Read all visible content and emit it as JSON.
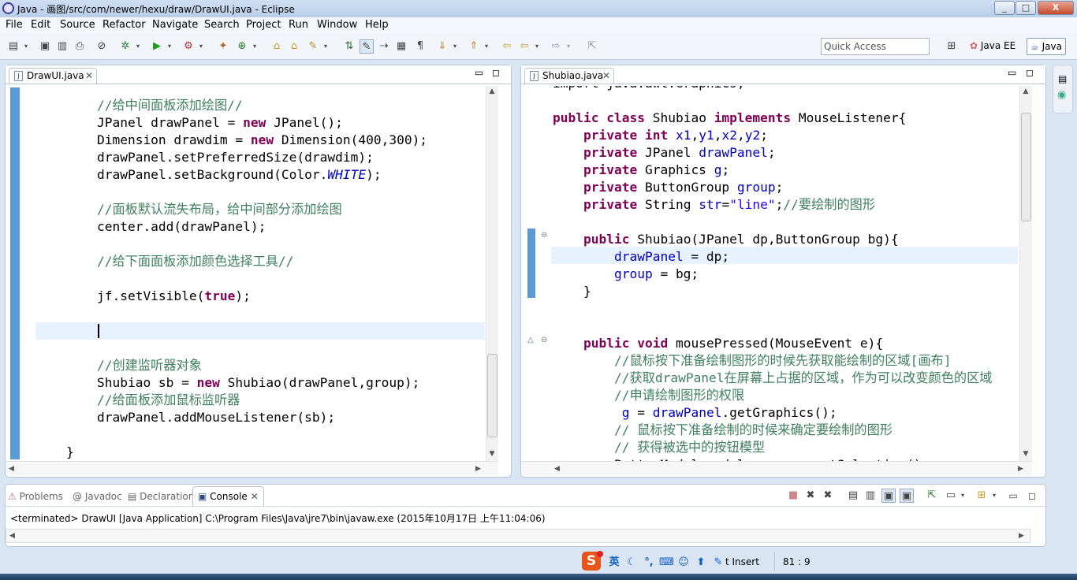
{
  "window": {
    "title": "Java - 画图/src/com/newer/hexu/draw/DrawUI.java - Eclipse",
    "minimize": "_",
    "maximize": "□",
    "close": "X"
  },
  "menu": [
    "File",
    "Edit",
    "Source",
    "Refactor",
    "Navigate",
    "Search",
    "Project",
    "Run",
    "Window",
    "Help"
  ],
  "quick_access": {
    "placeholder": "Quick Access"
  },
  "perspectives": [
    "Java EE",
    "Java"
  ],
  "editor_left": {
    "tab": "DrawUI.java",
    "lines": [
      [
        {
          "t": "        "
        },
        {
          "t": "//给中间面板添加绘图//",
          "c": "cm"
        }
      ],
      [
        {
          "t": "        JPanel drawPanel = "
        },
        {
          "t": "new",
          "c": "kw"
        },
        {
          "t": " JPanel();"
        }
      ],
      [
        {
          "t": "        Dimension drawdim = "
        },
        {
          "t": "new",
          "c": "kw"
        },
        {
          "t": " Dimension(400,300);"
        }
      ],
      [
        {
          "t": "        drawPanel.setPreferredSize(drawdim);"
        }
      ],
      [
        {
          "t": "        drawPanel.setBackground(Color."
        },
        {
          "t": "WHITE",
          "c": "it"
        },
        {
          "t": ");"
        }
      ],
      [
        {
          "t": ""
        }
      ],
      [
        {
          "t": "        "
        },
        {
          "t": "//面板默认流失布局，给中间部分添加绘图",
          "c": "cm"
        }
      ],
      [
        {
          "t": "        center.add(drawPanel);"
        }
      ],
      [
        {
          "t": ""
        }
      ],
      [
        {
          "t": "        "
        },
        {
          "t": "//给下面面板添加颜色选择工具//",
          "c": "cm"
        }
      ],
      [
        {
          "t": ""
        }
      ],
      [
        {
          "t": "        jf.setVisible("
        },
        {
          "t": "true",
          "c": "kw"
        },
        {
          "t": ");"
        }
      ],
      [
        {
          "t": ""
        }
      ],
      [
        {
          "t": ""
        }
      ],
      [
        {
          "t": ""
        }
      ],
      [
        {
          "t": "        "
        },
        {
          "t": "//创建监听器对象",
          "c": "cm"
        }
      ],
      [
        {
          "t": "        Shubiao sb = "
        },
        {
          "t": "new",
          "c": "kw"
        },
        {
          "t": " Shubiao(drawPanel,group);"
        }
      ],
      [
        {
          "t": "        "
        },
        {
          "t": "//给面板添加鼠标监听器",
          "c": "cm"
        }
      ],
      [
        {
          "t": "        drawPanel.addMouseListener(sb);"
        }
      ],
      [
        {
          "t": ""
        }
      ],
      [
        {
          "t": "    }"
        }
      ]
    ]
  },
  "editor_right": {
    "tab": "Shubiao.java",
    "lines": [
      [
        {
          "t": "import java.awt.Graphics;"
        }
      ],
      [
        {
          "t": ""
        }
      ],
      [
        {
          "t": "public",
          "c": "kw"
        },
        {
          "t": " "
        },
        {
          "t": "class",
          "c": "kw"
        },
        {
          "t": " Shubiao "
        },
        {
          "t": "implements",
          "c": "kw"
        },
        {
          "t": " MouseListener{"
        }
      ],
      [
        {
          "t": "    "
        },
        {
          "t": "private",
          "c": "kw"
        },
        {
          "t": " "
        },
        {
          "t": "int",
          "c": "kw"
        },
        {
          "t": " "
        },
        {
          "t": "x1",
          "c": "fld"
        },
        {
          "t": ","
        },
        {
          "t": "y1",
          "c": "fld"
        },
        {
          "t": ","
        },
        {
          "t": "x2",
          "c": "fld"
        },
        {
          "t": ","
        },
        {
          "t": "y2",
          "c": "fld"
        },
        {
          "t": ";"
        }
      ],
      [
        {
          "t": "    "
        },
        {
          "t": "private",
          "c": "kw"
        },
        {
          "t": " JPanel "
        },
        {
          "t": "drawPanel",
          "c": "fld"
        },
        {
          "t": ";"
        }
      ],
      [
        {
          "t": "    "
        },
        {
          "t": "private",
          "c": "kw"
        },
        {
          "t": " Graphics "
        },
        {
          "t": "g",
          "c": "fld"
        },
        {
          "t": ";"
        }
      ],
      [
        {
          "t": "    "
        },
        {
          "t": "private",
          "c": "kw"
        },
        {
          "t": " ButtonGroup "
        },
        {
          "t": "group",
          "c": "fld"
        },
        {
          "t": ";"
        }
      ],
      [
        {
          "t": "    "
        },
        {
          "t": "private",
          "c": "kw"
        },
        {
          "t": " String "
        },
        {
          "t": "str",
          "c": "fld"
        },
        {
          "t": "="
        },
        {
          "t": "\"line\"",
          "c": "st"
        },
        {
          "t": ";"
        },
        {
          "t": "//要绘制的图形",
          "c": "cm"
        }
      ],
      [
        {
          "t": ""
        }
      ],
      [
        {
          "t": "    "
        },
        {
          "t": "public",
          "c": "kw"
        },
        {
          "t": " Shubiao(JPanel dp,ButtonGroup bg){"
        }
      ],
      [
        {
          "t": "        "
        },
        {
          "t": "drawPanel",
          "c": "fld"
        },
        {
          "t": " = dp;"
        }
      ],
      [
        {
          "t": "        "
        },
        {
          "t": "group",
          "c": "fld"
        },
        {
          "t": " = bg;"
        }
      ],
      [
        {
          "t": "    }"
        }
      ],
      [
        {
          "t": ""
        }
      ],
      [
        {
          "t": ""
        }
      ],
      [
        {
          "t": "    "
        },
        {
          "t": "public",
          "c": "kw"
        },
        {
          "t": " "
        },
        {
          "t": "void",
          "c": "kw"
        },
        {
          "t": " mousePressed(MouseEvent e){"
        }
      ],
      [
        {
          "t": "        "
        },
        {
          "t": "//鼠标按下准备绘制图形的时候先获取能绘制的区域[画布]",
          "c": "cm"
        }
      ],
      [
        {
          "t": "        "
        },
        {
          "t": "//获取drawPanel在屏幕上占据的区域，作为可以改变颜色的区域",
          "c": "cm"
        }
      ],
      [
        {
          "t": "        "
        },
        {
          "t": "//申请绘制图形的权限",
          "c": "cm"
        }
      ],
      [
        {
          "t": "         "
        },
        {
          "t": "g",
          "c": "fld"
        },
        {
          "t": " = "
        },
        {
          "t": "drawPanel",
          "c": "fld"
        },
        {
          "t": ".getGraphics();"
        }
      ],
      [
        {
          "t": "        "
        },
        {
          "t": "// 鼠标按下准备绘制的时候来确定要绘制的图形",
          "c": "cm"
        }
      ],
      [
        {
          "t": "        "
        },
        {
          "t": "// 获得被选中的按钮模型",
          "c": "cm"
        }
      ],
      [
        {
          "t": "        ButtonModel model = group.getSelection();"
        }
      ]
    ]
  },
  "bottom_tabs": [
    "Problems",
    "Javadoc",
    "Declaration",
    "Console"
  ],
  "console": {
    "text": "<terminated> DrawUI [Java Application] C:\\Program Files\\Java\\jre7\\bin\\javaw.exe (2015年10月17日 上午11:04:06)"
  },
  "status": {
    "insert_mode": "t Insert",
    "position": "81 : 9"
  },
  "ime": {
    "lang": "英",
    "logo": "S"
  }
}
